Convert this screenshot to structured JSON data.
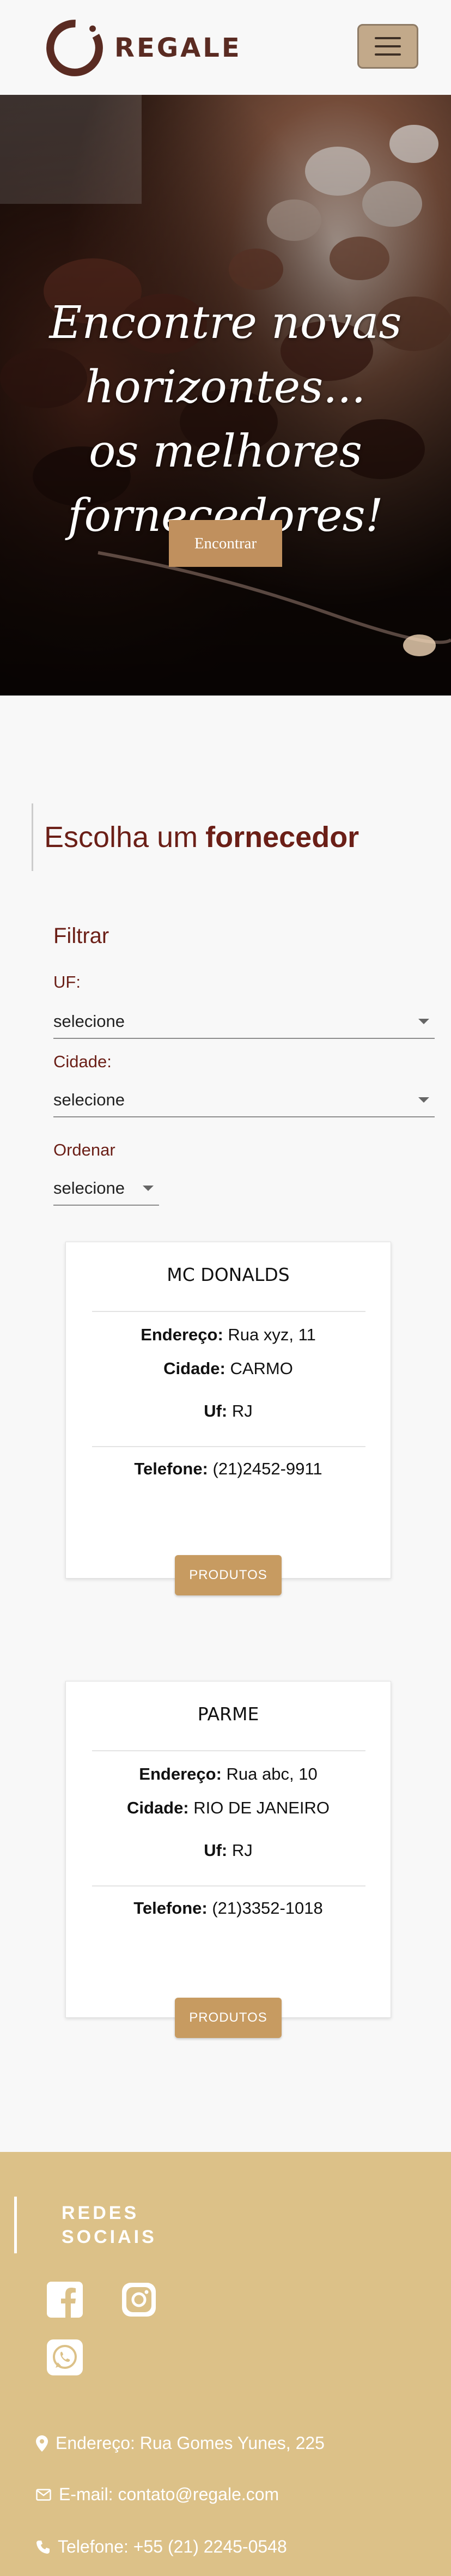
{
  "brand": {
    "name": "REGALE"
  },
  "hero": {
    "line1": "Encontre novas",
    "line2": "horizontes...",
    "line3": "os melhores fornecedores!",
    "button_label": "Encontrar"
  },
  "section": {
    "title_prefix": "Escolha um",
    "title_bold": "fornecedor"
  },
  "filters": {
    "heading": "Filtrar",
    "uf_label": "UF:",
    "uf_value": "selecione",
    "city_label": "Cidade:",
    "city_value": "selecione",
    "order_label": "Ordenar",
    "order_value": "selecione"
  },
  "suppliers": [
    {
      "name": "MC DONALDS",
      "address_label": "Endereço:",
      "address": "Rua xyz, 11",
      "city_label": "Cidade:",
      "city": "CARMO",
      "uf_label": "Uf:",
      "uf": "RJ",
      "phone_label": "Telefone:",
      "phone": "(21)2452-9911",
      "button_label": "PRODUTOS"
    },
    {
      "name": "PARME",
      "address_label": "Endereço:",
      "address": "Rua abc, 10",
      "city_label": "Cidade:",
      "city": "RIO DE JANEIRO",
      "uf_label": "Uf:",
      "uf": "RJ",
      "phone_label": "Telefone:",
      "phone": "(21)3352-1018",
      "button_label": "PRODUTOS"
    }
  ],
  "footer": {
    "social_heading_1": "REDES",
    "social_heading_2": "SOCIAIS",
    "social_icons": [
      "facebook-icon",
      "instagram-icon",
      "whatsapp-icon"
    ],
    "address": "Endereço: Rua Gomes Yunes, 225",
    "email": "E-mail: contato@regale.com",
    "phone": "Telefone: +55 (21) 2245-0548"
  },
  "colors": {
    "brand_dark": "#5a2b22",
    "accent": "#c79b61",
    "title_red": "#6b1f17",
    "footer_bg": "#dcc188"
  }
}
